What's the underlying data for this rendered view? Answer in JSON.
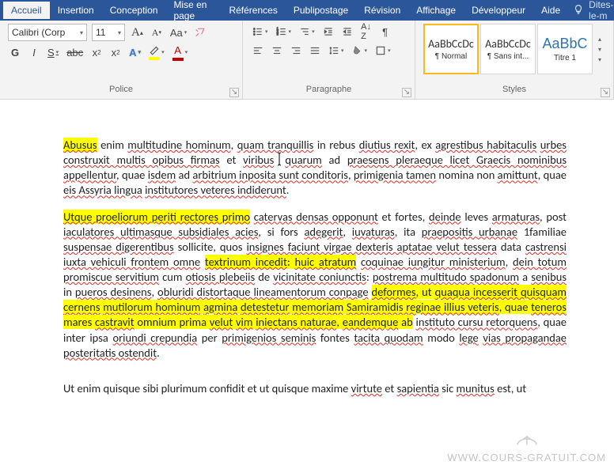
{
  "tabs": {
    "items": [
      "Accueil",
      "Insertion",
      "Conception",
      "Mise en page",
      "Références",
      "Publipostage",
      "Révision",
      "Affichage",
      "Développeur",
      "Aide"
    ],
    "active": 0,
    "tellme": "Dites-le-m"
  },
  "font_group": {
    "title": "Police",
    "name": "Calibri (Corp",
    "size": "11"
  },
  "para_group": {
    "title": "Paragraphe"
  },
  "styles_group": {
    "title": "Styles",
    "items": [
      {
        "preview": "AaBbCcDc",
        "label": "¶ Normal",
        "selected": true,
        "cls": ""
      },
      {
        "preview": "AaBbCcDc",
        "label": "¶ Sans int...",
        "selected": false,
        "cls": ""
      },
      {
        "preview": "AaBbC",
        "label": "Titre 1",
        "selected": false,
        "cls": "h1"
      }
    ]
  },
  "doc": {
    "p1_a": "Abusus",
    "p1_b": " enim ",
    "p1_c": "multitudine hominum",
    "p1_d": ", ",
    "p1_e": "quam tranquillis",
    "p1_f": " in rebus ",
    "p1_g": "diutius rexit",
    "p1_h": ", ex ",
    "p1_i": "agrestibus habitaculis",
    "p1_j": " ",
    "p1_k": "urbes construxit multis opibus firmas",
    "p1_l": " et ",
    "p1_m": "viribus",
    "p1_n": "quarum",
    "p1_o": " ad ",
    "p1_p": "praesens pleraeque licet Graecis nominibus appellentur",
    "p1_q": ", quae ",
    "p1_r": "isdem",
    "p1_s": " ad ",
    "p1_t": "arbitrium inposita sunt conditoris",
    "p1_u": ", ",
    "p1_v": "primigenia tamen",
    "p1_w": " nomina non ",
    "p1_x": "amittunt",
    "p1_y": ", quae ",
    "p1_z": "eis Assyria lingua",
    "p1_aa": " ",
    "p1_ab": "institutores veteres indiderunt",
    "p1_ac": ".",
    "p2_a": "Utque proeliorum periti rectores primo",
    "p2_a2": " ",
    "p2_b": "catervas densas opponunt",
    "p2_c": " et fortes, ",
    "p2_d": "deinde",
    "p2_e": " leves ",
    "p2_f": "armaturas",
    "p2_g": ", post ",
    "p2_h": "iaculatores ultimasque subsidiales acies",
    "p2_i": ", si fors ",
    "p2_j": "adegerit",
    "p2_k": ", ",
    "p2_l": "iuvaturas",
    "p2_m": ", ita ",
    "p2_n": "praepositis urbanae",
    "p2_o": " 1familiae ",
    "p2_p": "suspensae digerentibus",
    "p2_q": " sollicite, quos ",
    "p2_r": "insignes faciunt virgae dexteris aptatae velut tessera",
    "p2_s": " data ",
    "p2_t": "castrensi iuxta vehiculi frontem omne",
    "p2_u": " ",
    "p2_v": "textrinum incedit",
    "p2_w": ": ",
    "p2_x": "huic atratum",
    "p2_x2": " ",
    "p2_y": "coquinae iungitur ministerium",
    "p2_z": ", ",
    "p2_aa": "dein totum promiscue servitium",
    "p2_ab": " cum ",
    "p2_ac": "otiosis plebeiis",
    "p2_ad": " de ",
    "p2_ae": "vicinitate coniunctis",
    "p2_af": ": ",
    "p2_ag": "postrema multitudo spadonum",
    "p2_ah": " a ",
    "p2_ai": "senibus",
    "p2_aj": " in ",
    "p2_ak": "pueros desinens",
    "p2_al": ", ",
    "p2_am": "obluridi distortaque lineamentorum conpage",
    "p2_an": " ",
    "p2_ao": "deformes",
    "p2_ap": ", ut ",
    "p2_aq": "quaqua incesserit quisquam",
    "p2_ar": " ",
    "p2_as": "cernens",
    "p2_at": " ",
    "p2_au": "mutilorum hominum",
    "p2_av": " ",
    "p2_aw": "agmina",
    "p2_ax": " ",
    "p2_ay": "detestetur",
    "p2_az": " ",
    "p2_ba": "memoriam",
    "p2_bb": " ",
    "p2_bc": "Samiramidis reginae illius veteris",
    "p2_bd": ", quae ",
    "p2_be": "teneros",
    "p2_bf": " mares ",
    "p2_bg": "castravit",
    "p2_bh": " omnium prima ",
    "p2_bi": "velut",
    "p2_bj": " ",
    "p2_bk": "vim",
    "p2_bl": " ",
    "p2_bm": "iniectans naturae",
    "p2_bn": ", ",
    "p2_bo": "eandemque",
    "p2_bp": " ",
    "p2_bq": "ab",
    "p2_bq2": " ",
    "p2_br": "instituto cursu retorquens",
    "p2_bs": ", quae inter ipsa ",
    "p2_bt": "oriundi crepundia",
    "p2_bu": " per ",
    "p2_bv": "primigenios seminis",
    "p2_bw": " fontes ",
    "p2_bx": "tacita quodam",
    "p2_by": " modo ",
    "p2_bz": "lege",
    "p2_ca": " ",
    "p2_cb": "vias propagandae posteritatis ostendit",
    "p2_cc": ".",
    "p3_a": "Ut enim quisque sibi plurimum confidit et ut quisque maxime ",
    "p3_b": "virtute",
    "p3_c": " et ",
    "p3_d": "sapientia",
    "p3_e": " sic ",
    "p3_f": "munitus",
    "p3_g": " est, ut"
  },
  "watermark": "WWW.COURS-GRATUIT.COM"
}
